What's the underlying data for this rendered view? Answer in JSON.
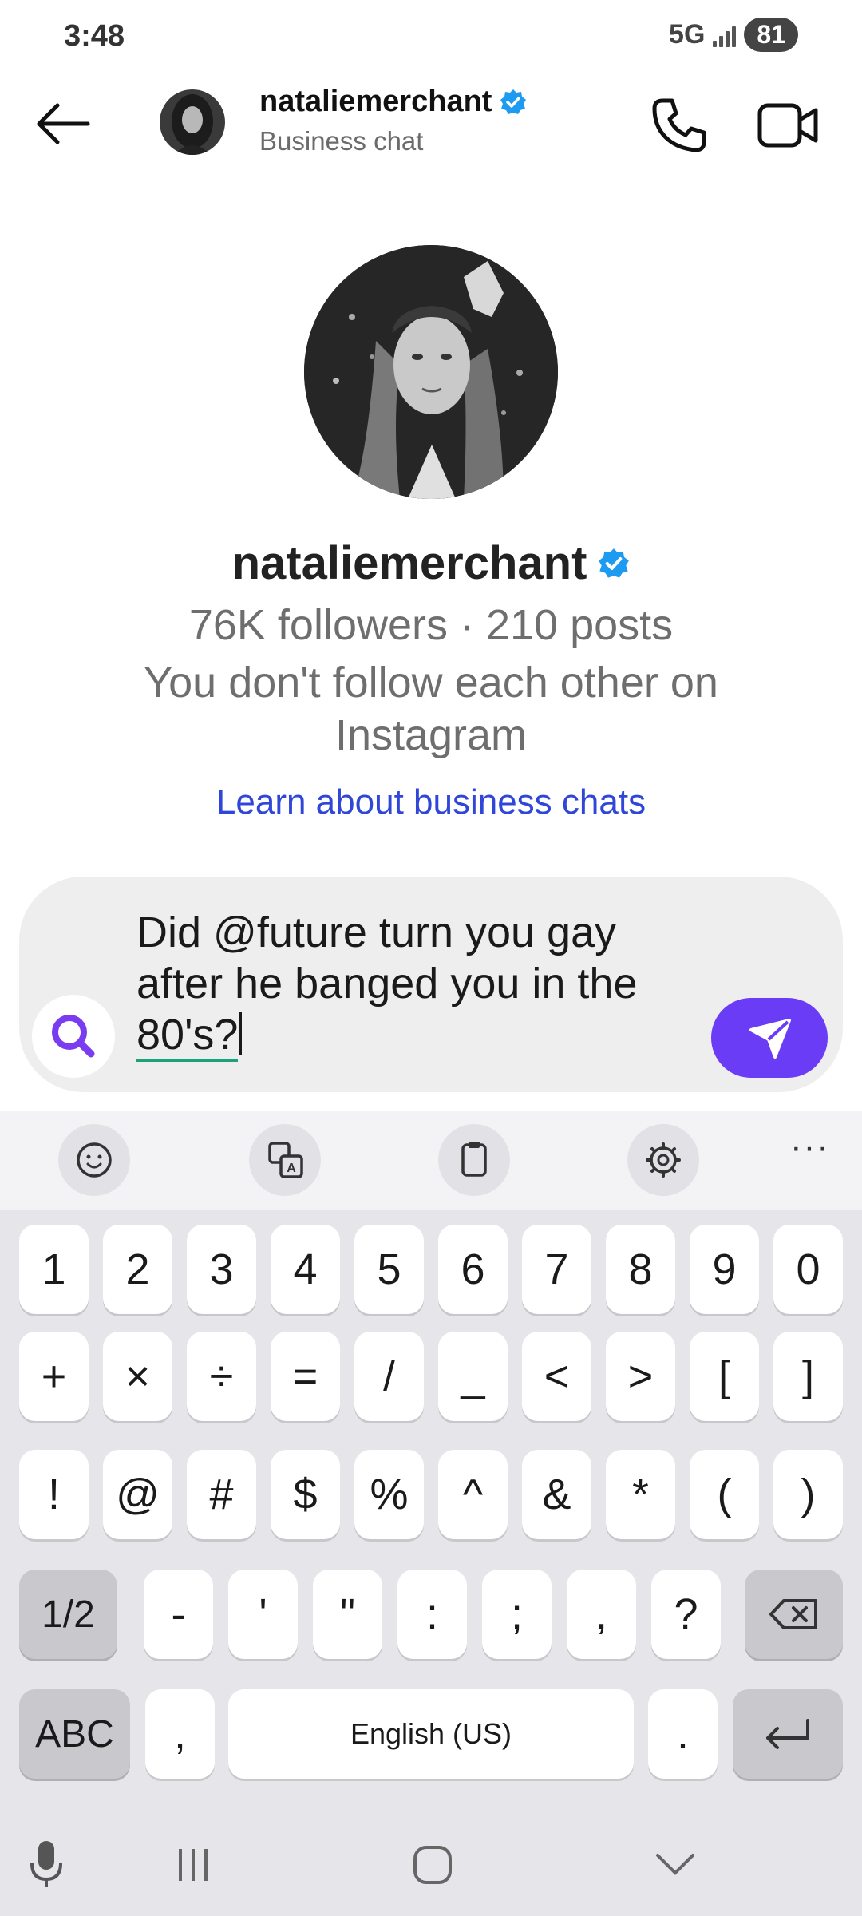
{
  "status_bar": {
    "time": "3:48",
    "network": "5G",
    "battery": "81"
  },
  "header": {
    "name": "nataliemerchant",
    "subtitle": "Business chat"
  },
  "profile": {
    "name": "nataliemerchant",
    "stats": "76K followers · 210 posts",
    "follow_status": "You don't follow each other on Instagram",
    "learn_link": "Learn about business chats"
  },
  "composer": {
    "text_main": "Did @future turn you gay after he banged you in the ",
    "text_tail": "80's?"
  },
  "keyboard": {
    "toolbar": [
      "emoji-icon",
      "translate-icon",
      "clipboard-icon",
      "settings-icon",
      "more-icon"
    ],
    "more_label": "···",
    "row1": [
      "1",
      "2",
      "3",
      "4",
      "5",
      "6",
      "7",
      "8",
      "9",
      "0"
    ],
    "row2": [
      "+",
      "×",
      "÷",
      "=",
      "/",
      "_",
      "<",
      ">",
      "[",
      "]"
    ],
    "row3": [
      "!",
      "@",
      "#",
      "$",
      "%",
      "^",
      "&",
      "*",
      "(",
      ")"
    ],
    "row4_toggle": "1/2",
    "row4": [
      "-",
      "'",
      "\"",
      ":",
      ";",
      ",",
      "?"
    ],
    "row5_abc": "ABC",
    "row5_comma": ",",
    "row5_space": "English (US)",
    "row5_period": "."
  },
  "colors": {
    "accent": "#6b3cf5",
    "verified": "#1d9bf0",
    "link": "#2f46d8"
  }
}
